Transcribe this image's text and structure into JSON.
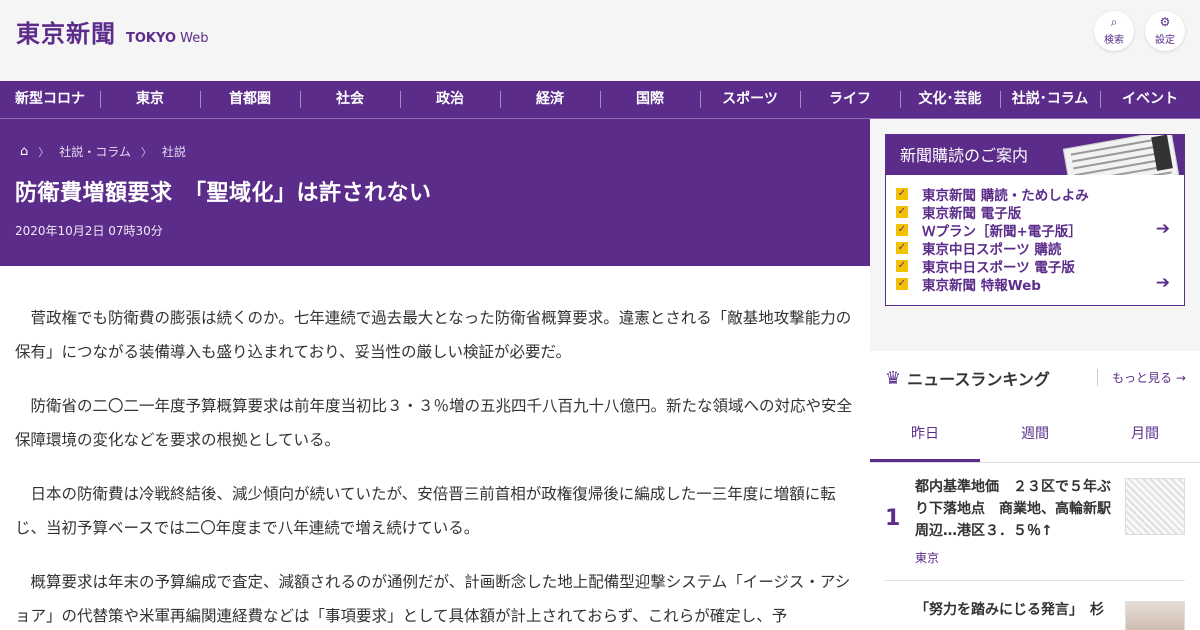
{
  "header": {
    "logo_jp": "東京新聞",
    "logo_en_bold": "TOKYO",
    "logo_en_light": "Web",
    "search_label": "検索",
    "settings_label": "設定"
  },
  "nav": [
    "新型コロナ",
    "東京",
    "首都圏",
    "社会",
    "政治",
    "経済",
    "国際",
    "スポーツ",
    "ライフ",
    "文化･芸能",
    "社説･コラム",
    "イベント"
  ],
  "breadcrumb": {
    "home_icon": "home-icon",
    "items": [
      "社説・コラム",
      "社説"
    ]
  },
  "article": {
    "title": "防衛費増額要求　「聖域化」は許されない",
    "date": "2020年10月2日 07時30分",
    "paragraphs": [
      "菅政権でも防衛費の膨張は続くのか。七年連続で過去最大となった防衛省概算要求。違憲とされる「敵基地攻撃能力の保有」につながる装備導入も盛り込まれており、妥当性の厳しい検証が必要だ。",
      "防衛省の二〇二一年度予算概算要求は前年度当初比３・３％増の五兆四千八百九十八億円。新たな領域への対応や安全保障環境の変化などを要求の根拠としている。",
      "日本の防衛費は冷戦終結後、減少傾向が続いていたが、安倍晋三前首相が政権復帰後に編成した一三年度に増額に転じ、当初予算ベースでは二〇年度まで八年連続で増え続けている。",
      "概算要求は年末の予算編成で査定、減額されるのが通例だが、計画断念した地上配備型迎撃システム「イージス・アショア」の代替策や米軍再編関連経費などは「事項要求」として具体額が計上されておらず、これらが確定し、予"
    ]
  },
  "subscription": {
    "heading": "新聞購読のご案内",
    "items": [
      "東京新聞 購読・ためしよみ",
      "東京新聞 電子版",
      "Ｗプラン［新聞+電子版］",
      "東京中日スポーツ 購読",
      "東京中日スポーツ 電子版",
      "東京新聞 特報Web"
    ]
  },
  "ranking": {
    "heading": "ニュースランキング",
    "more": "もっと見る",
    "tabs": [
      "昨日",
      "週間",
      "月間"
    ],
    "active_tab": "昨日",
    "items": [
      {
        "rank": "1",
        "title": "都内基準地価　２３区で５年ぶり下落地点　商業地、高輪新駅周辺…港区３．５％↑",
        "category": "東京"
      },
      {
        "rank": "",
        "title": "「努力を踏みにじる発言」　杉",
        "category": ""
      }
    ]
  },
  "colors": {
    "brand_purple": "#5b2c8a",
    "check_yellow": "#f2c200"
  }
}
